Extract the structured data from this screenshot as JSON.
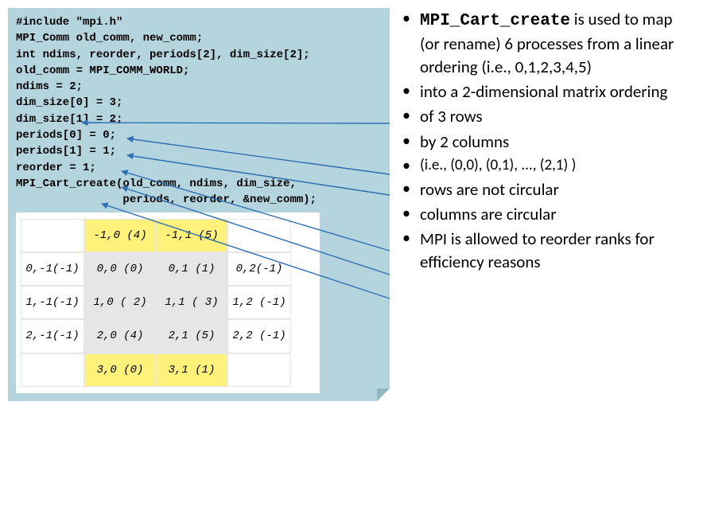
{
  "code": {
    "l1": "#include \"mpi.h\"",
    "l2": "MPI_Comm old_comm, new_comm;",
    "l3": "int ndims, reorder, periods[2], dim_size[2];",
    "l4": "",
    "l5": "old_comm = MPI_COMM_WORLD;",
    "l6": "",
    "l7": "ndims = 2;",
    "l8": "dim_size[0] = 3;",
    "l9": "dim_size[1] = 2;",
    "l10": "periods[0] = 0;",
    "l11": "periods[1] = 1;",
    "l12": "reorder = 1;",
    "l13": "",
    "l14": "MPI_Cart_create(old_comm, ndims, dim_size,",
    "l15": "                periods, reorder, &new_comm);"
  },
  "table": {
    "r0c0": "",
    "r0c1": "-1,0 (4)",
    "r0c2": "-1,1 (5)",
    "r0c3": "",
    "r1c0": "0,-1(-1)",
    "r1c1": "0,0 (0)",
    "r1c2": "0,1 (1)",
    "r1c3": "0,2(-1)",
    "r2c0": "1,-1(-1)",
    "r2c1": "1,0 ( 2)",
    "r2c2": "1,1 ( 3)",
    "r2c3": "1,2 (-1)",
    "r3c0": "2,-1(-1)",
    "r3c1": "2,0 (4)",
    "r3c2": "2,1 (5)",
    "r3c3": "2,2 (-1)",
    "r4c0": "",
    "r4c1": "3,0 (0)",
    "r4c2": "3,1 (1)",
    "r4c3": ""
  },
  "bullets": {
    "b1a": "MPI_Cart_create",
    "b1b": " is used to map (or rename) 6 processes from a linear ordering (i.e., 0,1,2,3,4,5)",
    "b2": "into a 2-dimensional matrix ordering",
    "b3": "of 3 rows",
    "b4": "by 2 columns",
    "b4s": "(i.e., (0,0), (0,1), ..., (2,1) )",
    "b5": "rows are not circular",
    "b6": "columns are circular",
    "b7": "MPI is allowed to reorder ranks for efficiency reasons"
  }
}
